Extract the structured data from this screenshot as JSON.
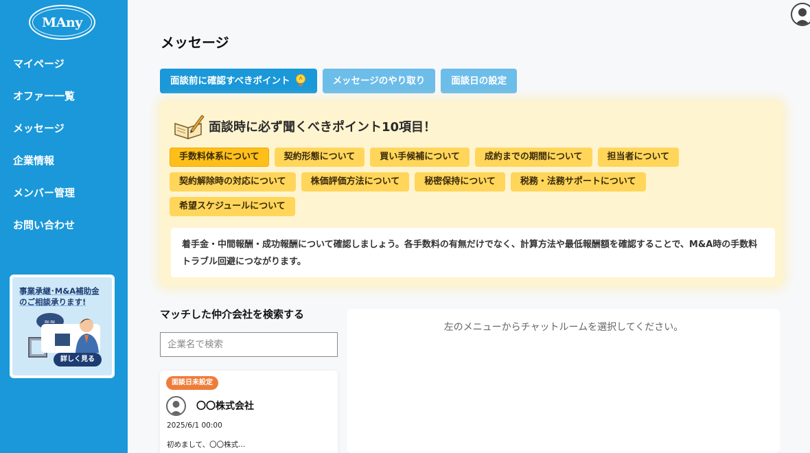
{
  "app": {
    "logo_text": "MAny"
  },
  "sidebar": {
    "items": [
      {
        "label": "マイページ"
      },
      {
        "label": "オファー一覧"
      },
      {
        "label": "メッセージ"
      },
      {
        "label": "企業情報"
      },
      {
        "label": "メンバー管理"
      },
      {
        "label": "お問い合わせ"
      }
    ],
    "banner": {
      "title_line1": "事業承継･M&A補助金",
      "title_line2": "のご相談承ります!",
      "button_label": "詳しく見る"
    }
  },
  "page": {
    "title": "メッセージ"
  },
  "tabs": [
    {
      "label": "面談前に確認すべきポイント",
      "active": true,
      "icon": "lightbulb-icon"
    },
    {
      "label": "メッセージのやり取り",
      "active": false
    },
    {
      "label": "面談日の設定",
      "active": false
    }
  ],
  "points": {
    "title": "面談時に必ず聞くべきポイント10項目！",
    "chips_row1": [
      "手数料体系について",
      "契約形態について",
      "買い手候補について",
      "成約までの期間について",
      "担当者について"
    ],
    "chips_row2": [
      "契約解除時の対応について",
      "株価評価方法について",
      "秘密保持について",
      "税務・法務サポートについて"
    ],
    "chips_row3": [
      "希望スケジュールについて"
    ],
    "selected": "手数料体系について",
    "description": "着手金・中間報酬・成功報酬について確認しましょう。各手数料の有無だけでなく、計算方法や最低報酬額を確認することで、M&A時の手数料トラブル回避につながります。"
  },
  "search": {
    "label": "マッチした仲介会社を検索する",
    "placeholder": "企業名で検索",
    "value": ""
  },
  "message_card": {
    "badge": "面談日未設定",
    "company": "〇〇株式会社",
    "date": "2025/6/1 00:00",
    "preview": "初めまして、〇〇株式..."
  },
  "chat": {
    "empty_text": "左のメニューからチャットルームを選択してください。"
  },
  "colors": {
    "sidebar": "#1a98d9",
    "tab_active": "#1a98d9",
    "tab_inactive": "#6cbde9",
    "chip": "#ffd65a",
    "badge": "#ee7d3a"
  }
}
